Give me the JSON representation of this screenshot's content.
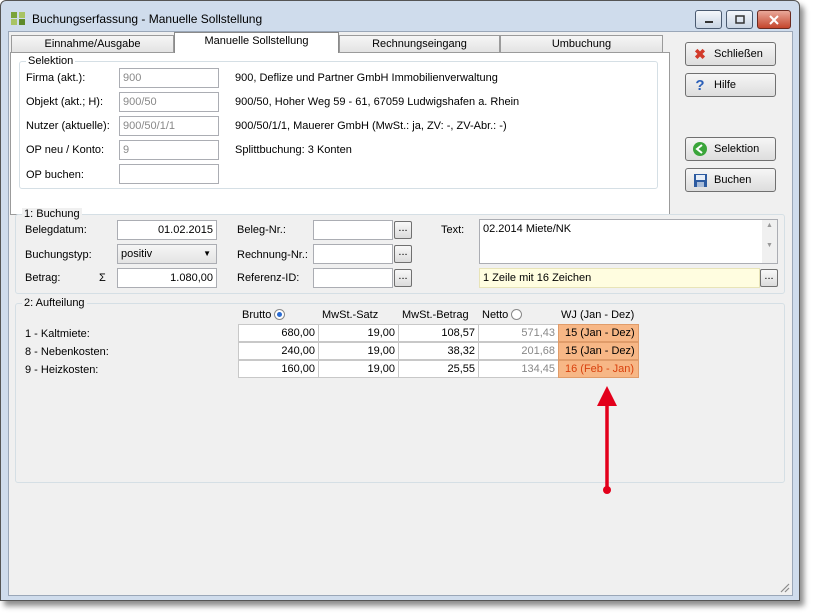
{
  "window": {
    "title": "Buchungserfassung - Manuelle Sollstellung"
  },
  "tabs": [
    {
      "label": "Einnahme/Ausgabe"
    },
    {
      "label": "Manuelle Sollstellung"
    },
    {
      "label": "Rechnungseingang"
    },
    {
      "label": "Umbuchung"
    }
  ],
  "selektion": {
    "title": "Selektion",
    "firma_label": "Firma (akt.):",
    "firma_value": "900",
    "firma_desc": "900,  Deflize und Partner GmbH Immobilienverwaltung",
    "objekt_label": "Objekt (akt.; H):",
    "objekt_value": "900/50",
    "objekt_desc": "900/50,  Hoher Weg 59 - 61, 67059 Ludwigshafen a. Rhein",
    "nutzer_label": "Nutzer (aktuelle):",
    "nutzer_value": "900/50/1/1",
    "nutzer_desc": "900/50/1/1,  Mauerer GmbH  (MwSt.: ja,  ZV: -, ZV-Abr.: -)",
    "op_label": "OP neu / Konto:",
    "op_value": "9",
    "op_desc": "Splittbuchung:  3 Konten",
    "op_buchen_label": "OP buchen:",
    "op_buchen_value": ""
  },
  "buttons": {
    "schliessen": "Schließen",
    "hilfe": "Hilfe",
    "selektion": "Selektion",
    "buchen": "Buchen"
  },
  "buchung": {
    "title": "1: Buchung",
    "belegdatum_label": "Belegdatum:",
    "belegdatum_value": "01.02.2015",
    "buchungstyp_label": "Buchungstyp:",
    "buchungstyp_value": "positiv",
    "betrag_label": "Betrag:",
    "betrag_symbol": "Σ",
    "betrag_value": "1.080,00",
    "beleg_label": "Beleg-Nr.:",
    "beleg_value": "",
    "rechnung_label": "Rechnung-Nr.:",
    "rechnung_value": "",
    "referenz_label": "Referenz-ID:",
    "referenz_value": "",
    "dots": "...",
    "text_label": "Text:",
    "text_value": "02.2014 Miete/NK",
    "text_info": "1 Zeile mit 16 Zeichen"
  },
  "aufteilung": {
    "title": "2: Aufteilung",
    "headers": {
      "brutto": "Brutto",
      "mwst_satz": "MwSt.-Satz",
      "mwst_betrag": "MwSt.-Betrag",
      "netto": "Netto",
      "wj": "WJ  (Jan - Dez)"
    },
    "rows": [
      {
        "label": "1 - Kaltmiete:",
        "brutto": "680,00",
        "satz": "19,00",
        "betrag": "108,57",
        "netto": "571,43",
        "wj": "15 (Jan - Dez)"
      },
      {
        "label": "8 - Nebenkosten:",
        "brutto": "240,00",
        "satz": "19,00",
        "betrag": "38,32",
        "netto": "201,68",
        "wj": "15 (Jan - Dez)"
      },
      {
        "label": "9 - Heizkosten:",
        "brutto": "160,00",
        "satz": "19,00",
        "betrag": "25,55",
        "netto": "134,45",
        "wj": "16 (Feb - Jan)"
      }
    ]
  },
  "colors": {
    "highlight": "#f7b786",
    "arrow": "#e3001b",
    "highlight_text_alt": "#d9420f"
  }
}
